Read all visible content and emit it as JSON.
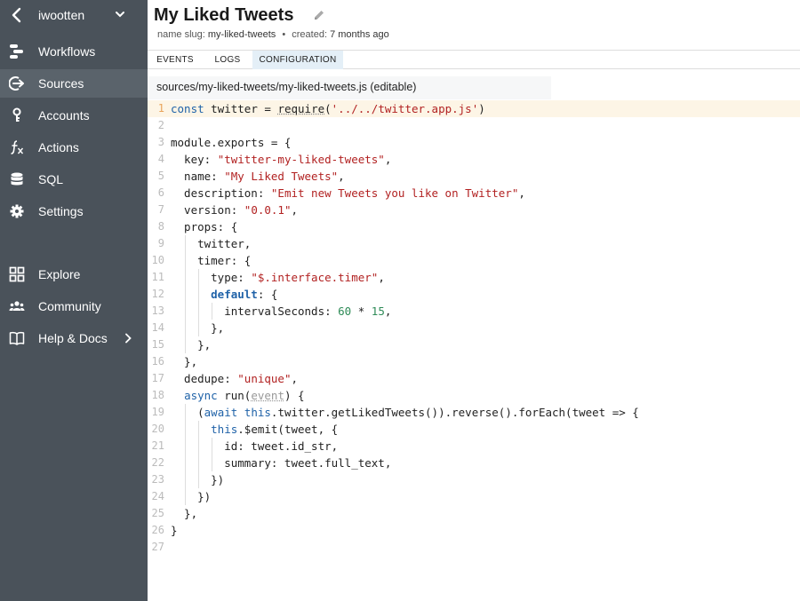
{
  "sidebar": {
    "username": "iwootten",
    "items": [
      {
        "label": "Workflows",
        "icon": "workflows-icon"
      },
      {
        "label": "Sources",
        "icon": "sources-icon",
        "active": true
      },
      {
        "label": "Accounts",
        "icon": "key-icon"
      },
      {
        "label": "Actions",
        "icon": "function-icon"
      },
      {
        "label": "SQL",
        "icon": "database-icon"
      },
      {
        "label": "Settings",
        "icon": "gear-icon"
      },
      {
        "label": "Explore",
        "icon": "grid-icon"
      },
      {
        "label": "Community",
        "icon": "people-icon"
      },
      {
        "label": "Help & Docs",
        "icon": "book-icon"
      }
    ]
  },
  "header": {
    "title": "My Liked Tweets",
    "slug_label": "name slug:",
    "slug_value": "my-liked-tweets",
    "separator": "•",
    "created_label": "created:",
    "created_value": "7 months ago"
  },
  "tabs": [
    {
      "label": "EVENTS"
    },
    {
      "label": "LOGS"
    },
    {
      "label": "CONFIGURATION",
      "active": true
    }
  ],
  "file": {
    "path": "sources/my-liked-tweets/my-liked-tweets.js (editable)"
  },
  "editor": {
    "active_line": 1,
    "line_numbers": [
      "1",
      "2",
      "3",
      "4",
      "5",
      "6",
      "7",
      "8",
      "9",
      "10",
      "11",
      "12",
      "13",
      "14",
      "15",
      "16",
      "17",
      "18",
      "19",
      "20",
      "21",
      "22",
      "23",
      "24",
      "25",
      "26",
      "27"
    ],
    "lines": [
      "const twitter = require('../../twitter.app.js')",
      "",
      "module.exports = {",
      "  key: \"twitter-my-liked-tweets\",",
      "  name: \"My Liked Tweets\",",
      "  description: \"Emit new Tweets you like on Twitter\",",
      "  version: \"0.0.1\",",
      "  props: {",
      "    twitter,",
      "    timer: {",
      "      type: \"$.interface.timer\",",
      "      default: {",
      "        intervalSeconds: 60 * 15,",
      "      },",
      "    },",
      "  },",
      "  dedupe: \"unique\",",
      "  async run(event) {",
      "    (await this.twitter.getLikedTweets()).reverse().forEach(tweet => {",
      "      this.$emit(tweet, {",
      "        id: tweet.id_str,",
      "        summary: tweet.full_text,",
      "      })",
      "    })",
      "  },",
      "}",
      ""
    ]
  }
}
